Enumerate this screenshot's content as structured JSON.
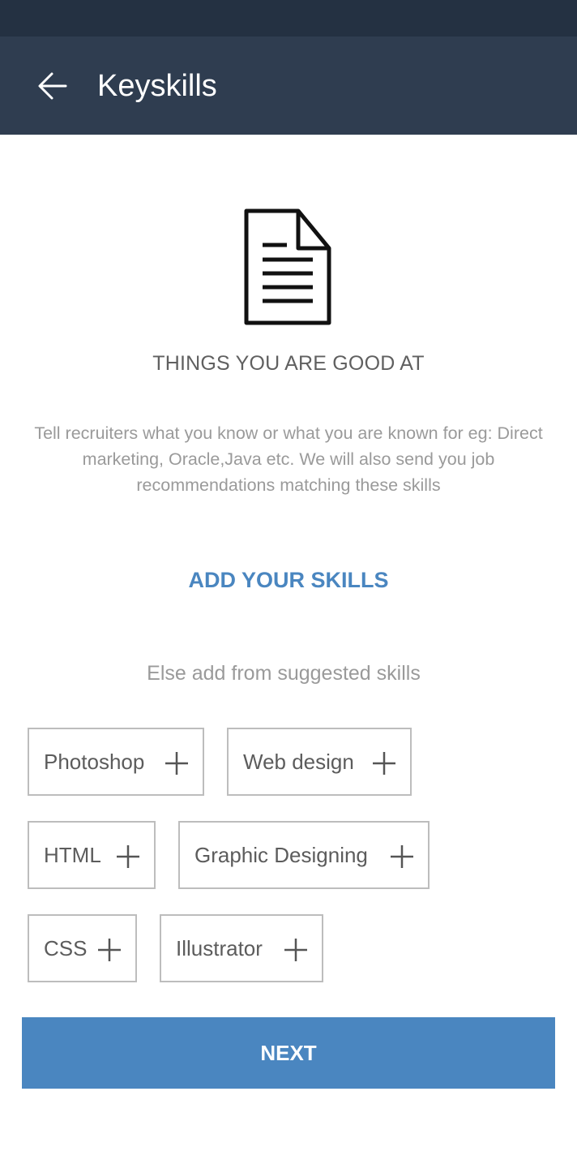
{
  "header": {
    "title": "Keyskills",
    "back_icon": "arrow-left-icon"
  },
  "hero": {
    "icon": "document-icon",
    "heading": "THINGS YOU ARE GOOD AT",
    "description": "Tell recruiters what you know or what you are known for eg: Direct marketing, Oracle,Java etc. We will also send you job recommendations matching these skills"
  },
  "add_skills_label": "ADD YOUR SKILLS",
  "suggested": {
    "label": "Else add from suggested skills",
    "skills": [
      {
        "label": "Photoshop",
        "icon": "plus-icon"
      },
      {
        "label": "Web design",
        "icon": "plus-icon"
      },
      {
        "label": "HTML",
        "icon": "plus-icon"
      },
      {
        "label": "Graphic Designing",
        "icon": "plus-icon"
      },
      {
        "label": "CSS",
        "icon": "plus-icon"
      },
      {
        "label": "Illustrator",
        "icon": "plus-icon"
      }
    ]
  },
  "next_label": "NEXT",
  "colors": {
    "status_bar": "#243142",
    "app_bar": "#2f3d50",
    "accent": "#4a86c0",
    "chip_border": "#bdbdbd"
  }
}
